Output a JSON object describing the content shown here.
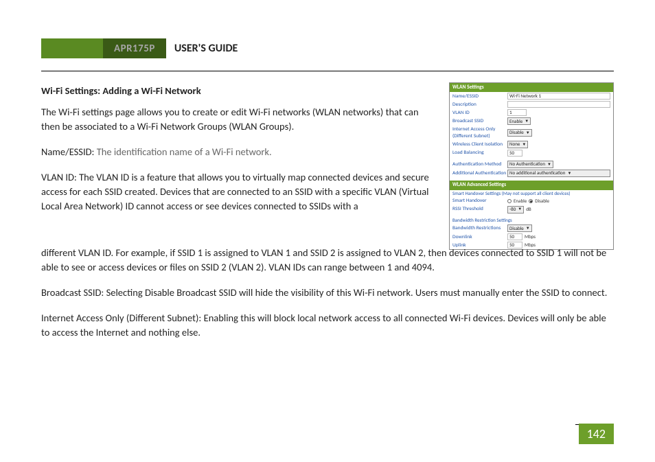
{
  "header": {
    "model": "APR175P",
    "title": "USER'S GUIDE"
  },
  "section_heading": "Wi-Fi Settings: Adding a Wi-Fi Network",
  "paragraphs": {
    "intro": "The Wi-Fi settings page allows you to create or edit Wi-Fi networks (WLAN networks) that can then be associated to a Wi-Fi Network Groups (WLAN Groups).",
    "name_label": "Name/ESSID:",
    "name_text": "The identification name of a Wi-Fi network.",
    "vlan_label": "VLAN ID:",
    "vlan_text_part1": "The VLAN ID is a feature that allows you to virtually map connected devices and secure access for each SSID created. Devices that are connected to an SSID with a specific VLAN (Virtual Local Area Network) ID cannot access or see devices connected to SSIDs with a",
    "vlan_text_part2": "different VLAN ID. For example, if SSID 1 is assigned to VLAN 1 and SSID 2 is assigned to VLAN 2, then devices connected to SSID 1 will not be able to see or access devices or files on SSID 2 (VLAN 2). VLAN IDs can range between 1 and 4094.",
    "broadcast_label": "Broadcast SSID:",
    "broadcast_text": "Selecting Disable Broadcast SSID will hide the visibility of this Wi-Fi network. Users must manually enter the SSID to connect.",
    "iao_label": "Internet Access Only (Different Subnet):",
    "iao_text": "Enabling this will block local network access to all connected Wi-Fi devices.  Devices will only be able to access the Internet and nothing else."
  },
  "panel": {
    "sections": {
      "wlan": "WLAN Settings",
      "adv": "WLAN Advanced Settings"
    },
    "rows": {
      "name": {
        "label": "Name/ESSID",
        "value": "Wi-Fi Network 1"
      },
      "desc": {
        "label": "Description",
        "value": ""
      },
      "vlan": {
        "label": "VLAN ID",
        "value": "1"
      },
      "broadcast": {
        "label": "Broadcast SSID",
        "value": "Enable"
      },
      "iao": {
        "label": "Internet Access Only (Different Subnet)",
        "value": "Disable"
      },
      "isolation": {
        "label": "Wireless Client Isolation",
        "value": "None"
      },
      "loadbal": {
        "label": "Load Balancing",
        "value": "50"
      },
      "auth": {
        "label": "Authentication Method",
        "value": "No Authentication"
      },
      "addauth": {
        "label": "Additional Authentication",
        "value": "No additional authentication"
      },
      "handover_note": "Smart Handover Settings (May not support all client devices)",
      "handover": {
        "label": "Smart Handover",
        "enable": "Enable",
        "disable": "Disable"
      },
      "rssi": {
        "label": "RSSI Threshold",
        "value": "-80",
        "unit": "dB"
      },
      "bw_heading": "Bandwidth Restriction Settings",
      "bwrestrict": {
        "label": "Bandwidth Restrictions",
        "value": "Disable"
      },
      "down": {
        "label": "Downlink",
        "value": "50",
        "unit": "Mbps"
      },
      "up": {
        "label": "Uplink",
        "value": "50",
        "unit": "Mbps"
      }
    }
  },
  "page_number": "142"
}
